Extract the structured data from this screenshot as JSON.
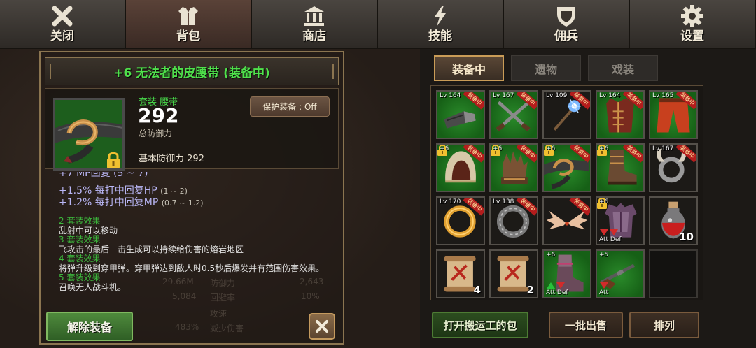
{
  "nav": {
    "items": [
      {
        "label": "关闭",
        "icon": "close-x-icon"
      },
      {
        "label": "背包",
        "icon": "armor-icon"
      },
      {
        "label": "商店",
        "icon": "shop-icon"
      },
      {
        "label": "技能",
        "icon": "lightning-icon"
      },
      {
        "label": "佣兵",
        "icon": "shield-icon"
      },
      {
        "label": "设置",
        "icon": "gear-icon"
      }
    ],
    "active_index": 1
  },
  "item": {
    "title": "+6 无法者的皮腰带 (装备中)",
    "type_label": "套装 腰带",
    "defense_value": "292",
    "defense_label": "总防御力",
    "base_defense": "基本防御力 292",
    "protect_button": "保护装备 : Off",
    "partial_line": "+7 MP回复 (5 ~ 7)",
    "stat_lines": [
      {
        "text": "+1.5% 每打中回复HP",
        "range": "(1 ~ 2)"
      },
      {
        "text": "+1.2% 每打中回复MP",
        "range": "(0.7 ~ 1.2)"
      }
    ],
    "set_effects": [
      {
        "head": "2 套装效果",
        "desc": "乱射中可以移动"
      },
      {
        "head": "3 套装效果",
        "desc": "飞攻击的最后一击生成可以持续给伤害的熔岩地区"
      },
      {
        "head": "4 套装效果",
        "desc": "将弹升级到穿甲弹。穿甲弹达到敌人时0.5秒后爆发并有范围伤害效果。"
      },
      {
        "head": "5 套装效果",
        "desc": "召唤无人战斗机。"
      }
    ],
    "unequip_button": "解除装备"
  },
  "inventory": {
    "tabs": [
      "装备中",
      "遗物",
      "戏装"
    ],
    "active_tab": 0,
    "equipped_tag": "装备中",
    "cells": [
      {
        "lv": "Lv 164",
        "equipped": true,
        "kind": "gauntlet-icon",
        "bg": "green"
      },
      {
        "lv": "Lv 167",
        "equipped": true,
        "kind": "crossed-guns-icon",
        "bg": "green"
      },
      {
        "lv": "Lv 109",
        "equipped": true,
        "kind": "magic-staff-icon",
        "bg": "plain"
      },
      {
        "lv": "Lv 164",
        "equipped": true,
        "kind": "leather-coat-icon",
        "bg": "green"
      },
      {
        "lv": "Lv 165",
        "equipped": true,
        "kind": "red-pants-icon",
        "bg": "green"
      },
      {
        "lv": "+6",
        "equipped": true,
        "kind": "hood-icon",
        "bg": "green",
        "lock": true
      },
      {
        "lv": "+6",
        "equipped": true,
        "kind": "glove-icon",
        "bg": "green",
        "lock": true
      },
      {
        "lv": "+6",
        "equipped": true,
        "kind": "belt-icon",
        "bg": "green",
        "lock": true
      },
      {
        "lv": "+6",
        "equipped": true,
        "kind": "boots-icon",
        "bg": "green",
        "lock": true
      },
      {
        "lv": "Lv 167",
        "equipped": true,
        "kind": "horn-ring-icon",
        "bg": "plain"
      },
      {
        "lv": "Lv 170",
        "equipped": true,
        "kind": "gold-ring-icon",
        "bg": "plain"
      },
      {
        "lv": "Lv 138",
        "equipped": true,
        "kind": "steel-ring-icon",
        "bg": "plain"
      },
      {
        "lv": "",
        "equipped": true,
        "kind": "wings-icon",
        "bg": "plain"
      },
      {
        "lv": "+6",
        "equipped": false,
        "kind": "purple-armor-icon",
        "bg": "plain",
        "attdef": "Att Def",
        "arrows": [
          "down",
          "down"
        ],
        "lock": true
      },
      {
        "lv": "",
        "equipped": false,
        "kind": "red-potion-icon",
        "bg": "plain",
        "count": "10"
      },
      {
        "lv": "",
        "equipped": false,
        "kind": "scroll-icon",
        "bg": "plain",
        "count": "4"
      },
      {
        "lv": "",
        "equipped": false,
        "kind": "scroll-icon",
        "bg": "plain",
        "count": "2"
      },
      {
        "lv": "+6",
        "equipped": false,
        "kind": "purple-boots-icon",
        "bg": "green",
        "attdef": "Att Def",
        "arrows": [
          "up",
          "down"
        ]
      },
      {
        "lv": "+5",
        "equipped": false,
        "kind": "rifle-icon",
        "bg": "green",
        "attdef": "Att",
        "arrows": [
          "down"
        ]
      },
      {
        "lv": "",
        "equipped": false,
        "kind": "empty-slot",
        "bg": "dark"
      }
    ],
    "buttons": {
      "open_porter_bag": "打开搬运工的包",
      "bulk_sell": "一批出售",
      "sort": "排列"
    }
  },
  "background_stats": [
    "29.66M",
    "防御力",
    "2,643",
    "5,084",
    "回避率",
    "10%",
    "攻速",
    "483%",
    "减少伤害"
  ]
}
